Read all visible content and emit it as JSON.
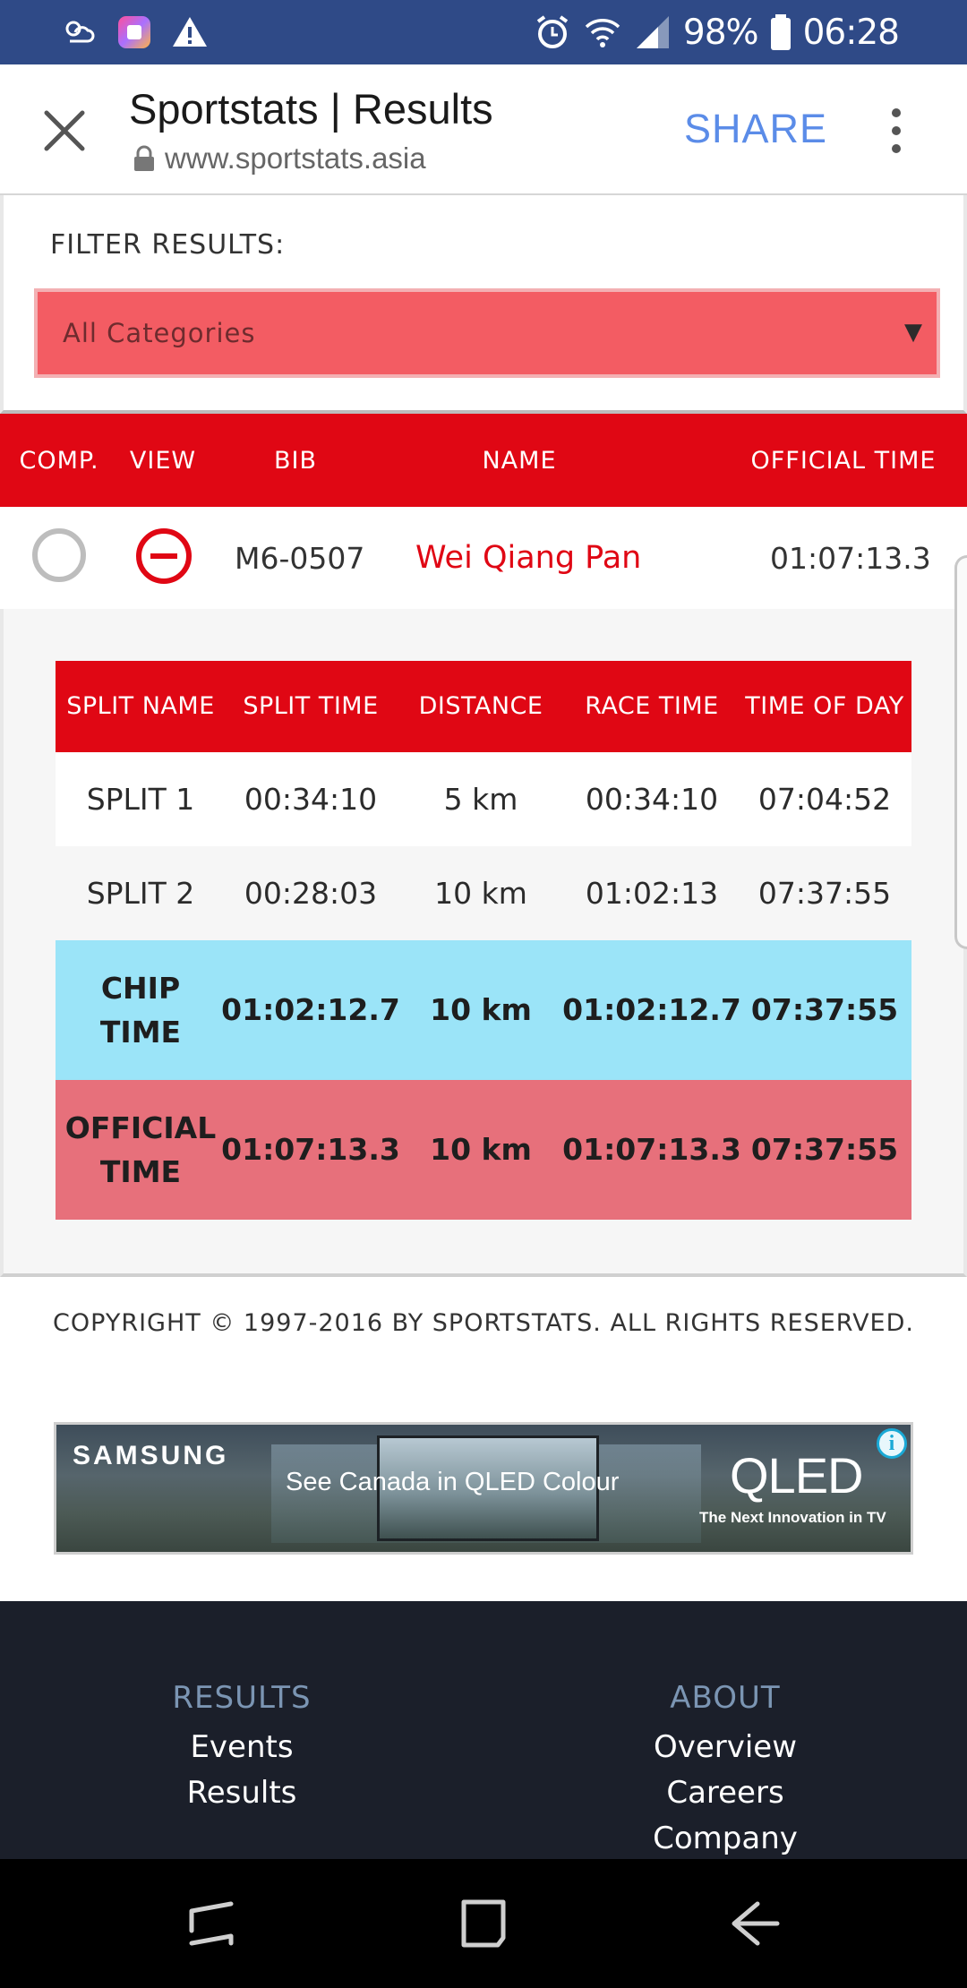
{
  "status_bar": {
    "battery": "98%",
    "time": "06:28",
    "icons": [
      "weather-icon",
      "app-icon",
      "warning-icon",
      "alarm-icon",
      "wifi-icon",
      "signal-icon",
      "battery-icon"
    ]
  },
  "browser": {
    "title": "Sportstats | Results",
    "url": "www.sportstats.asia",
    "share_label": "SHARE"
  },
  "filter": {
    "label": "FILTER RESULTS:",
    "selected": "All Categories"
  },
  "results_table": {
    "headers": [
      "COMP.",
      "VIEW",
      "BIB",
      "NAME",
      "OFFICIAL TIME"
    ],
    "row": {
      "bib": "M6-0507",
      "name": "Wei Qiang Pan",
      "official_time": "01:07:13.3"
    }
  },
  "splits": {
    "headers": [
      "SPLIT NAME",
      "SPLIT TIME",
      "DISTANCE",
      "RACE TIME",
      "TIME OF DAY"
    ],
    "rows": [
      {
        "name": "SPLIT 1",
        "split_time": "00:34:10",
        "distance": "5 km",
        "race_time": "00:34:10",
        "time_of_day": "07:04:52"
      },
      {
        "name": "SPLIT 2",
        "split_time": "00:28:03",
        "distance": "10 km",
        "race_time": "01:02:13",
        "time_of_day": "07:37:55"
      },
      {
        "name": "CHIP TIME",
        "split_time": "01:02:12.7",
        "distance": "10 km",
        "race_time": "01:02:12.7",
        "time_of_day": "07:37:55"
      },
      {
        "name": "OFFICIAL TIME",
        "split_time": "01:07:13.3",
        "distance": "10 km",
        "race_time": "01:07:13.3",
        "time_of_day": "07:37:55"
      }
    ]
  },
  "copyright": "COPYRIGHT © 1997-2016 BY SPORTSTATS. ALL RIGHTS RESERVED.",
  "ad": {
    "brand": "SAMSUNG",
    "tagline": "See Canada in QLED Colour",
    "product": "QLED",
    "subline": "The Next Innovation in TV",
    "info_glyph": "i"
  },
  "footer": {
    "results": {
      "heading": "RESULTS",
      "links": [
        "Events",
        "Results"
      ]
    },
    "about": {
      "heading": "ABOUT",
      "links": [
        "Overview",
        "Careers",
        "Company"
      ]
    }
  },
  "colors": {
    "status_bar": "#2f4a87",
    "accent_red": "#e00714",
    "filter_red": "#f35c63",
    "share_blue": "#5b8ce8",
    "chip_row": "#9be4f8",
    "official_row": "#e7707b",
    "footer_bg": "#1b1f2a",
    "footer_heading": "#7b95b3"
  }
}
